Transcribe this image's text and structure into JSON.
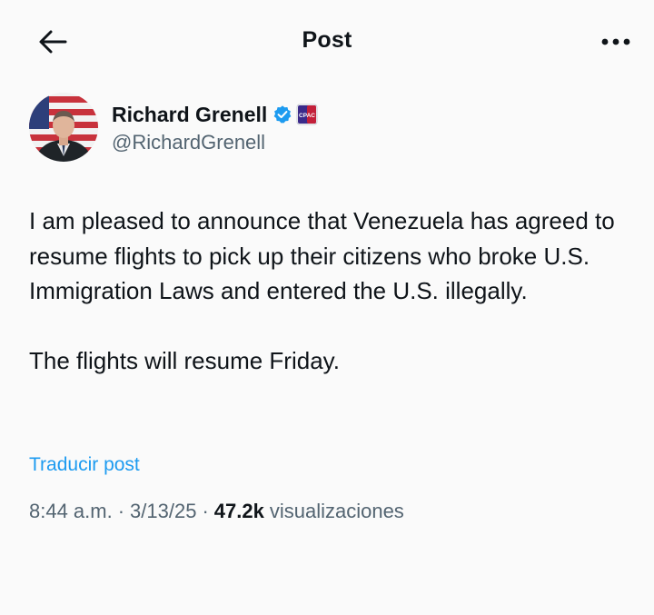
{
  "header": {
    "title": "Post",
    "back_icon": "arrow-left-icon",
    "more_icon": "more-horizontal-icon"
  },
  "author": {
    "display_name": "Richard Grenell",
    "handle": "@RichardGrenell",
    "verified_icon": "verified-badge-icon",
    "verified_color": "#1d9bf0",
    "affiliate_badge": "CPAC",
    "avatar_icon": "avatar"
  },
  "tweet": {
    "text": "I am pleased to announce that Venezuela has agreed to resume flights to pick up their citizens who broke U.S. Immigration Laws and entered the U.S. illegally.\n\nThe flights will resume Friday.",
    "translate_label": "Traducir post",
    "translate_color": "#1d9bf0"
  },
  "meta": {
    "time": "8:44 a.m.",
    "separator": "·",
    "date": "3/13/25",
    "views_count": "47.2k",
    "views_label": "visualizaciones"
  }
}
